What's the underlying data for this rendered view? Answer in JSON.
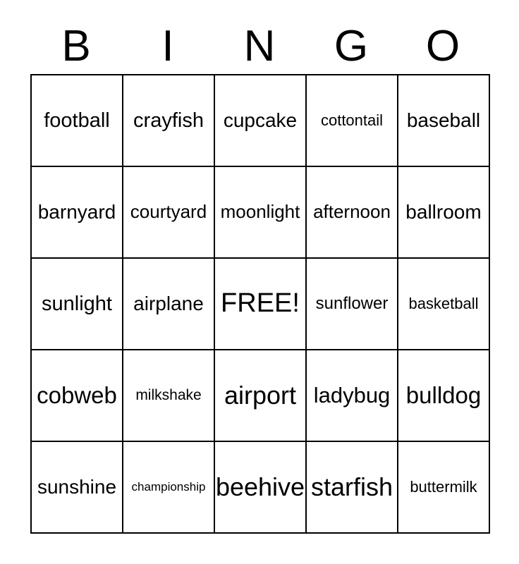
{
  "card": {
    "title": "BINGO",
    "header_letters": [
      "B",
      "I",
      "N",
      "G",
      "O"
    ],
    "free_space_label": "FREE!",
    "free_space_position": {
      "row": 2,
      "col": 2
    },
    "grid_size": "5x5",
    "colors": {
      "background": "#ffffff",
      "border": "#000000",
      "text": "#000000"
    },
    "rows": [
      [
        {
          "text": "football",
          "size": "fs-l"
        },
        {
          "text": "crayfish",
          "size": "fs-l"
        },
        {
          "text": "cupcake",
          "size": "fs-ml"
        },
        {
          "text": "cottontail",
          "size": "fs-s"
        },
        {
          "text": "baseball",
          "size": "fs-ml"
        }
      ],
      [
        {
          "text": "barnyard",
          "size": "fs-ml"
        },
        {
          "text": "courtyard",
          "size": "fs-m"
        },
        {
          "text": "moonlight",
          "size": "fs-m"
        },
        {
          "text": "afternoon",
          "size": "fs-m"
        },
        {
          "text": "ballroom",
          "size": "fs-ml"
        }
      ],
      [
        {
          "text": "sunlight",
          "size": "fs-l"
        },
        {
          "text": "airplane",
          "size": "fs-ml"
        },
        {
          "text": "FREE!",
          "size": "fs-4xl"
        },
        {
          "text": "sunflower",
          "size": "fs-sm"
        },
        {
          "text": "basketball",
          "size": "fs-s"
        }
      ],
      [
        {
          "text": "cobweb",
          "size": "fs-xxl"
        },
        {
          "text": "milkshake",
          "size": "fs-xs"
        },
        {
          "text": "airport",
          "size": "fs-3xl"
        },
        {
          "text": "ladybug",
          "size": "fs-xl"
        },
        {
          "text": "bulldog",
          "size": "fs-xxl"
        }
      ],
      [
        {
          "text": "sunshine",
          "size": "fs-ml"
        },
        {
          "text": "championship",
          "size": "fs-xxs"
        },
        {
          "text": "beehive",
          "size": "fs-3xl"
        },
        {
          "text": "starfish",
          "size": "fs-3xl"
        },
        {
          "text": "buttermilk",
          "size": "fs-s"
        }
      ]
    ]
  }
}
